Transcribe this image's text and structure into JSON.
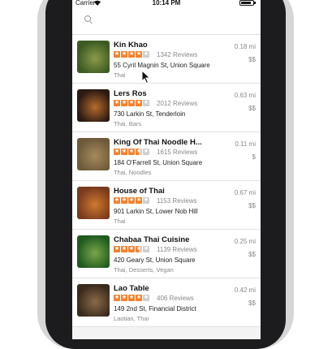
{
  "status_bar": {
    "carrier": "Carrier",
    "time": "10:14 PM",
    "battery_level": 0.85
  },
  "search": {
    "placeholder": ""
  },
  "colors": {
    "star_filled": "#f2822c",
    "star_empty": "#cfcfcf",
    "accent": "#f2822c"
  },
  "restaurants": [
    {
      "name": "Kin Khao",
      "rating": 4,
      "reviews": "1342 Reviews",
      "address": "55 Cyril Magnin St, Union Square",
      "categories": "Thai",
      "distance": "0.18 mi",
      "price": "$$",
      "thumb_colors": [
        "#3c5a22",
        "#8a9a4a"
      ]
    },
    {
      "name": "Lers Ros",
      "rating": 4,
      "reviews": "2012 Reviews",
      "address": "730 Larkin St, Tenderloin",
      "categories": "Thai, Bars",
      "distance": "0.63 mi",
      "price": "$$",
      "thumb_colors": [
        "#2a1a12",
        "#b86a2c"
      ]
    },
    {
      "name": "King Of Thai Noodle H...",
      "rating": 3.5,
      "reviews": "1615 Reviews",
      "address": "184 O'Farrell St, Union Square",
      "categories": "Thai, Noodles",
      "distance": "0.11 mi",
      "price": "$",
      "thumb_colors": [
        "#6e5a3a",
        "#a58a5c"
      ]
    },
    {
      "name": "House of Thai",
      "rating": 4,
      "reviews": "1153 Reviews",
      "address": "901 Larkin St, Lower Nob Hill",
      "categories": "Thai",
      "distance": "0.67 mi",
      "price": "$$",
      "thumb_colors": [
        "#7a3a1e",
        "#cf7a2c"
      ]
    },
    {
      "name": "Chabaa Thai Cuisine",
      "rating": 3.5,
      "reviews": "1139 Reviews",
      "address": "420 Geary St, Union Square",
      "categories": "Thai, Desserts, Vegan",
      "distance": "0.25 mi",
      "price": "$$",
      "thumb_colors": [
        "#1f5a1e",
        "#7aa64a"
      ]
    },
    {
      "name": "Lao Table",
      "rating": 4,
      "reviews": "406 Reviews",
      "address": "149 2nd St, Financial District",
      "categories": "Laotian, Thai",
      "distance": "0.42 mi",
      "price": "$$",
      "thumb_colors": [
        "#3a2a1c",
        "#8a6a4a"
      ]
    }
  ]
}
